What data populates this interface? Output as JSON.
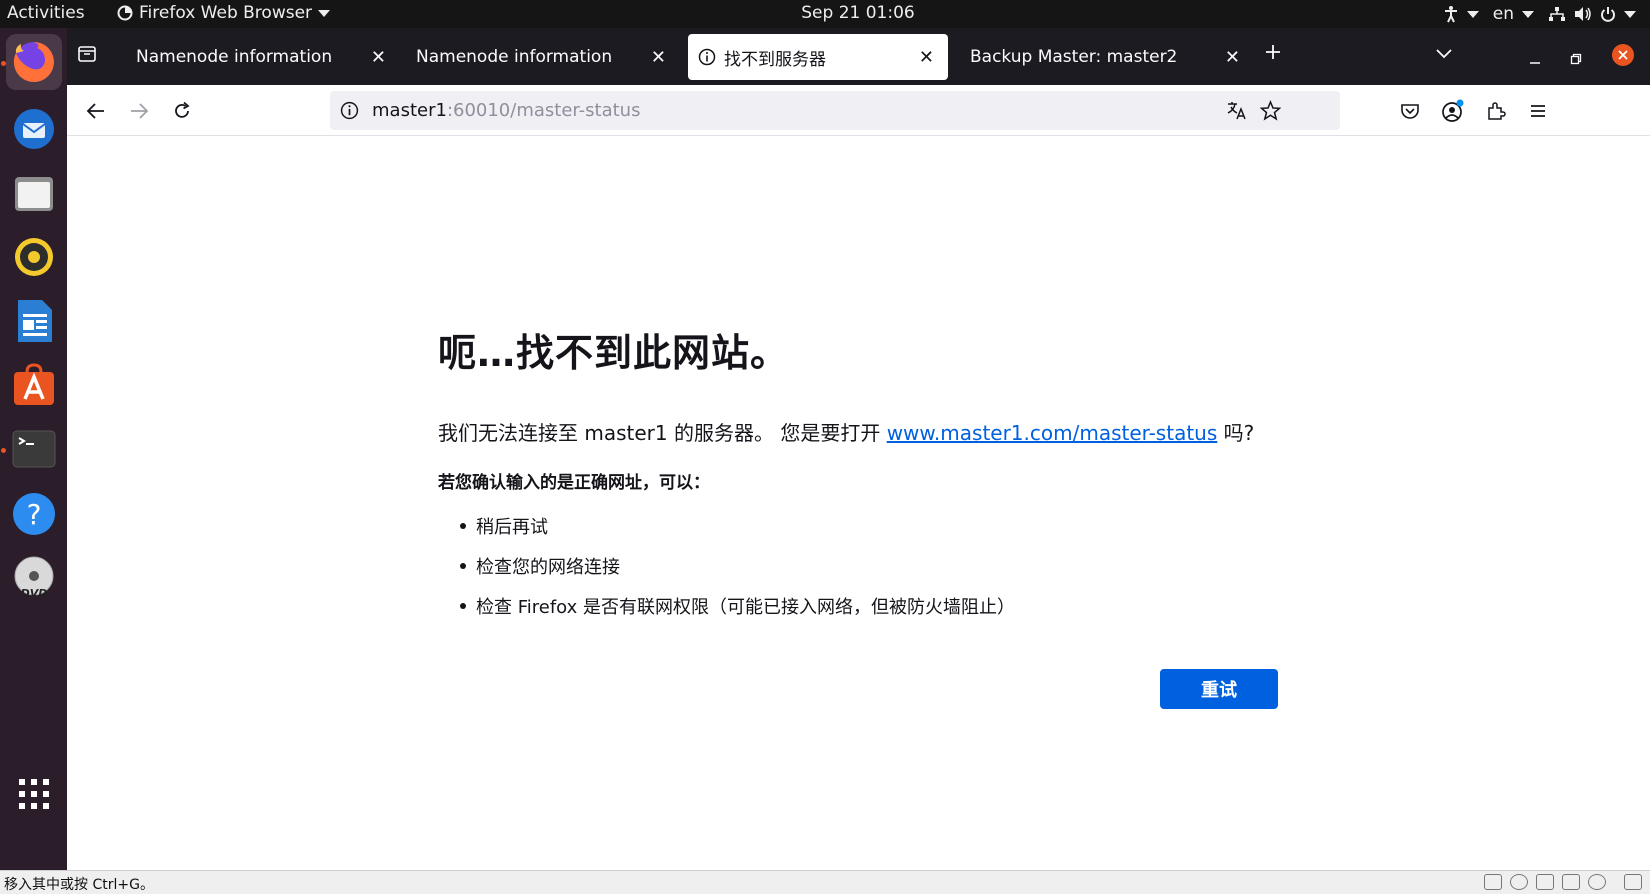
{
  "topbar": {
    "activities": "Activities",
    "app_name": "Firefox Web Browser",
    "clock": "Sep 21  01:06",
    "language": "en"
  },
  "dock": {
    "items": [
      {
        "name": "firefox",
        "icon": "firefox-icon"
      },
      {
        "name": "thunderbird",
        "icon": "thunderbird-icon"
      },
      {
        "name": "files",
        "icon": "files-icon"
      },
      {
        "name": "rhythmbox",
        "icon": "rhythmbox-icon"
      },
      {
        "name": "libreoffice-writer",
        "icon": "writer-icon"
      },
      {
        "name": "ubuntu-software",
        "icon": "software-icon"
      },
      {
        "name": "terminal",
        "icon": "terminal-icon"
      },
      {
        "name": "help",
        "icon": "help-icon"
      },
      {
        "name": "dvd",
        "icon": "dvd-icon"
      },
      {
        "name": "show-apps",
        "icon": "app-grid-icon"
      }
    ],
    "dvd_label": "DVD"
  },
  "tabs": [
    {
      "title": "Namenode information",
      "selected": false
    },
    {
      "title": "Namenode information",
      "selected": false
    },
    {
      "title": "找不到服务器",
      "selected": true
    },
    {
      "title": "Backup Master: master2",
      "selected": false
    }
  ],
  "urlbar": {
    "host": "master1",
    "path": ":60010/master-status"
  },
  "error_page": {
    "title": "呃…找不到此网站。",
    "desc_prefix": "我们无法连接至 master1 的服务器。 您是要打开 ",
    "suggested_link": "www.master1.com/master-status",
    "desc_suffix": " 吗?",
    "check_heading": "若您确认输入的是正确网址，可以：",
    "suggestions": [
      "稍后再试",
      "检查您的网络连接",
      "检查 Firefox 是否有联网权限（可能已接入网络，但被防火墙阻止）"
    ],
    "retry_label": "重试"
  },
  "statusbar": {
    "hint": "移入其中或按 Ctrl+G。"
  },
  "colors": {
    "accent_blue": "#0061e0",
    "ubuntu_orange": "#e95420",
    "dock_bg": "#2b1d2a",
    "tabstrip_bg": "#1c1b22"
  }
}
